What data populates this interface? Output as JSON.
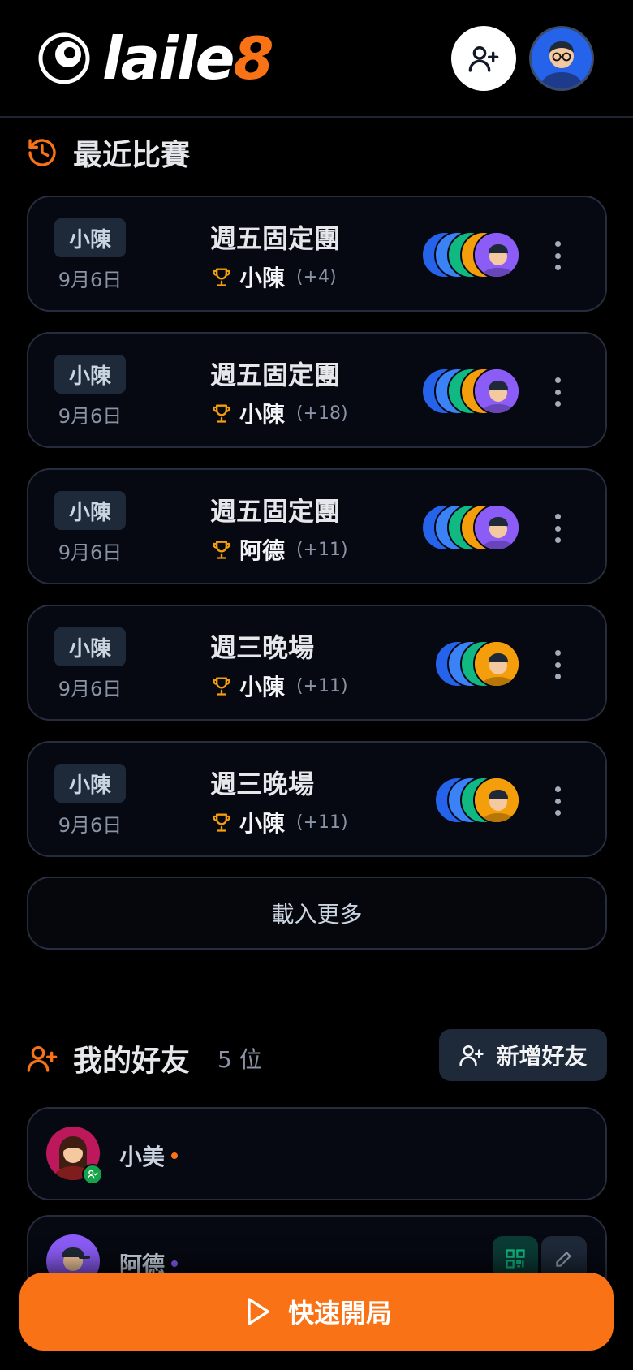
{
  "app": {
    "logo_text_main": "laile",
    "logo_text_accent": "8",
    "accent_color": "#f97316"
  },
  "header": {
    "add_friend_icon": "user-plus-icon",
    "profile_avatar": "avatar-glasses-man"
  },
  "recent": {
    "title": "最近比賽",
    "icon": "history-icon",
    "games": [
      {
        "host": "小陳",
        "date": "9月6日",
        "name": "週五固定團",
        "winner": "小陳",
        "score": "(+4)",
        "players": [
          "#2563eb",
          "#3b82f6",
          "#10b981",
          "#f59e0b",
          "#8b5cf6"
        ]
      },
      {
        "host": "小陳",
        "date": "9月6日",
        "name": "週五固定團",
        "winner": "小陳",
        "score": "(+18)",
        "players": [
          "#2563eb",
          "#3b82f6",
          "#10b981",
          "#f59e0b",
          "#8b5cf6"
        ]
      },
      {
        "host": "小陳",
        "date": "9月6日",
        "name": "週五固定團",
        "winner": "阿德",
        "score": "(+11)",
        "players": [
          "#2563eb",
          "#3b82f6",
          "#10b981",
          "#f59e0b",
          "#8b5cf6"
        ]
      },
      {
        "host": "小陳",
        "date": "9月6日",
        "name": "週三晚場",
        "winner": "小陳",
        "score": "(+11)",
        "players": [
          "#2563eb",
          "#3b82f6",
          "#10b981",
          "#f59e0b"
        ]
      },
      {
        "host": "小陳",
        "date": "9月6日",
        "name": "週三晚場",
        "winner": "小陳",
        "score": "(+11)",
        "players": [
          "#2563eb",
          "#3b82f6",
          "#10b981",
          "#f59e0b"
        ]
      }
    ],
    "load_more": "載入更多"
  },
  "friends": {
    "title": "我的好友",
    "count": "5 位",
    "add_button": "新增好友",
    "list": [
      {
        "name": "小美",
        "status_color": "#f97316"
      },
      {
        "name": "阿德",
        "status_color": "#8b5cf6"
      }
    ]
  },
  "footer": {
    "quick_start": "快速開局"
  }
}
